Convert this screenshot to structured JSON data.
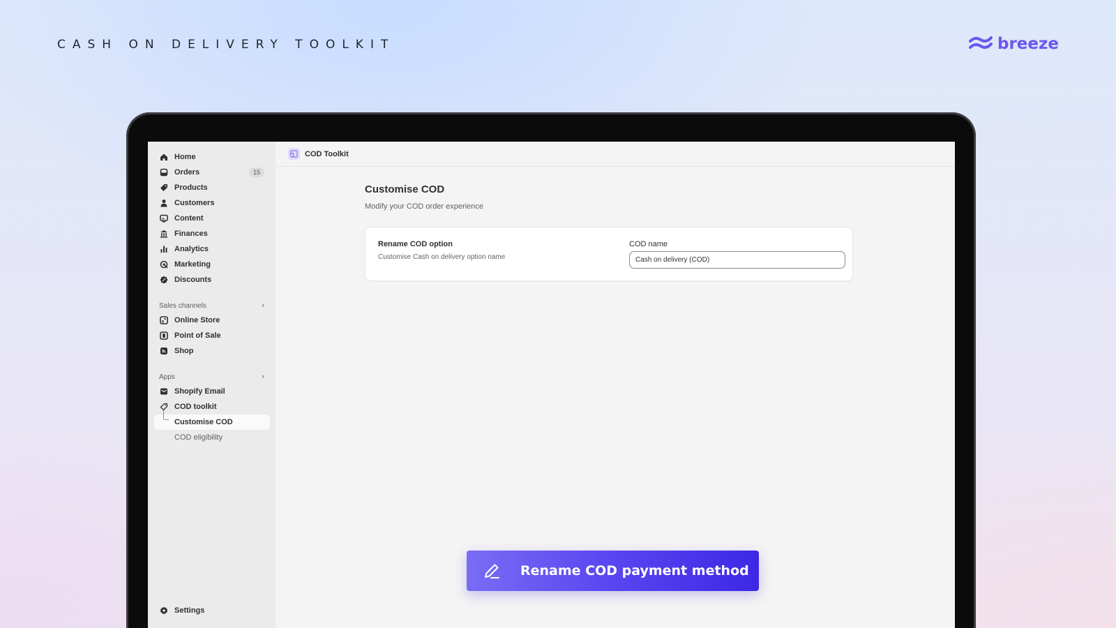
{
  "banner": {
    "title": "CASH ON DELIVERY TOOLKIT",
    "brand": "breeze"
  },
  "sidebar": {
    "items": [
      {
        "label": "Home",
        "icon": "home-icon"
      },
      {
        "label": "Orders",
        "icon": "orders-icon",
        "badge": "15"
      },
      {
        "label": "Products",
        "icon": "tag-icon"
      },
      {
        "label": "Customers",
        "icon": "person-icon"
      },
      {
        "label": "Content",
        "icon": "content-icon"
      },
      {
        "label": "Finances",
        "icon": "bank-icon"
      },
      {
        "label": "Analytics",
        "icon": "bar-chart-icon"
      },
      {
        "label": "Marketing",
        "icon": "target-icon"
      },
      {
        "label": "Discounts",
        "icon": "discount-icon"
      }
    ],
    "sales_channels": {
      "title": "Sales channels",
      "items": [
        {
          "label": "Online Store",
          "icon": "store-icon"
        },
        {
          "label": "Point of Sale",
          "icon": "pos-icon"
        },
        {
          "label": "Shop",
          "icon": "shop-icon"
        }
      ]
    },
    "apps": {
      "title": "Apps",
      "items": [
        {
          "label": "Shopify Email",
          "icon": "email-icon"
        },
        {
          "label": "COD toolkit",
          "icon": "tag-outline-icon"
        }
      ],
      "sub_items": [
        {
          "label": "Customise COD",
          "active": true
        },
        {
          "label": "COD eligibility",
          "active": false
        }
      ]
    },
    "settings": {
      "label": "Settings",
      "icon": "gear-icon"
    }
  },
  "topbar": {
    "app_name": "COD Toolkit"
  },
  "page": {
    "title": "Customise COD",
    "subtitle": "Modify your COD order experience",
    "card": {
      "label": "Rename COD option",
      "description": "Customise Cash on delivery option name",
      "field_label": "COD name",
      "field_value": "Cash on delivery (COD)"
    }
  },
  "cta": {
    "label": "Rename COD payment method",
    "icon": "pencil-icon"
  },
  "colors": {
    "brand": "#6b57f0",
    "cta_start": "#7a6cf5",
    "cta_end": "#3d28e6",
    "sidebar_bg": "#ebebeb"
  }
}
